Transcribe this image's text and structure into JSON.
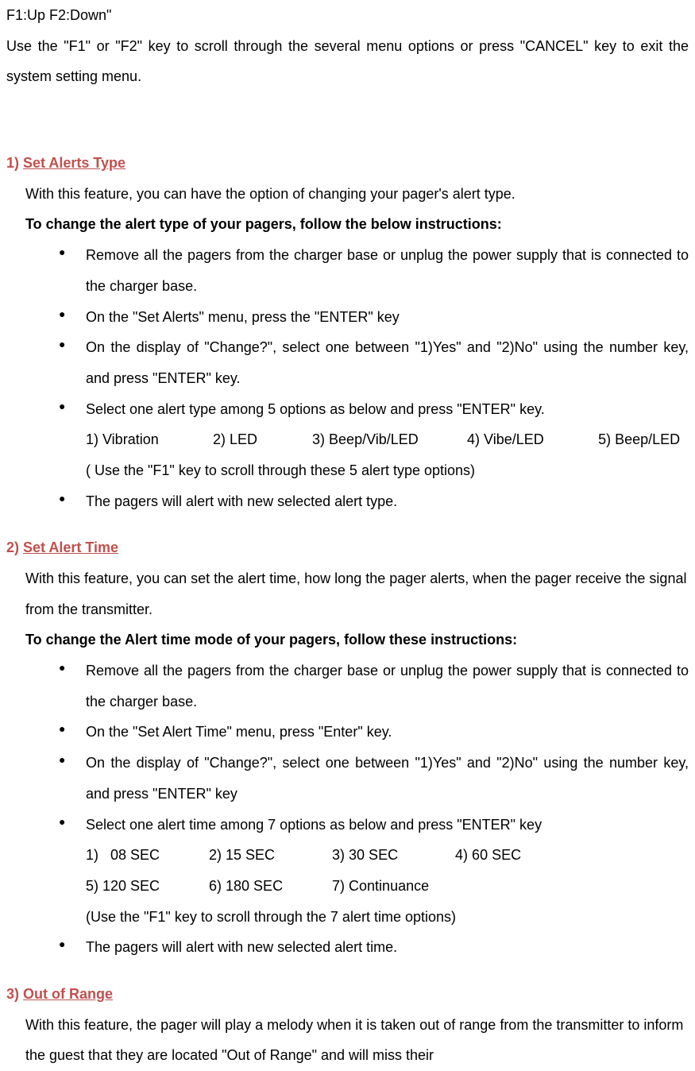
{
  "top": {
    "line1": "F1:Up   F2:Down\"",
    "line2": "Use the \"F1\" or \"F2\" key to scroll through the several menu options or press \"CANCEL\" key to exit the system setting menu."
  },
  "sections": {
    "s1": {
      "num": "1) ",
      "title": "Set Alerts Type",
      "intro": "With this feature, you can have the option of changing your pager's alert type.",
      "bold": "To change the alert type of your pagers, follow the below instructions:",
      "b1": "Remove all the pagers from the charger base or unplug the power supply that is connected to the charger base.",
      "b2": "On the \"Set Alerts\" menu, press the \"ENTER\" key",
      "b3": "On the display of \"Change?\", select one between \"1)Yes\" and \"2)No\" using the number key, and press \"ENTER\" key.",
      "b4": "Select one alert type among 5 options as below and press \"ENTER\" key.",
      "opts": {
        "o1": "1) Vibration",
        "o2": "2) LED",
        "o3": "3) Beep/Vib/LED",
        "o4": "4) Vibe/LED",
        "o5": "5) Beep/LED"
      },
      "note": "( Use the \"F1\" key to scroll through these 5 alert type options)",
      "b5": "The pagers will alert with new selected alert type."
    },
    "s2": {
      "num": "2) ",
      "title": "Set Alert Time",
      "intro": "With this feature, you can set the alert time, how long the pager alerts, when the pager receive the signal from the transmitter.",
      "bold": "To change the Alert time mode of your pagers, follow these instructions:",
      "b1": "Remove all the pagers from the charger base or unplug the power supply that is connected to the charger base.",
      "b2": "On the \"Set Alert Time\" menu, press \"Enter\" key.",
      "b3": "On the display of \"Change?\", select one between \"1)Yes\" and \"2)No\" using the number key, and press \"ENTER\" key",
      "b4": "Select one alert time among 7 options as below and press \"ENTER\" key",
      "opts1": {
        "o1": "1)   08 SEC",
        "o2": "2) 15 SEC",
        "o3": "3) 30 SEC",
        "o4": "4) 60 SEC"
      },
      "opts2": {
        "o5": "5) 120 SEC",
        "o6": "6) 180 SEC",
        "o7": "7) Continuance"
      },
      "note": "(Use the \"F1\" key to scroll through the 7 alert time options)",
      "b5": "The pagers will alert with new selected alert time."
    },
    "s3": {
      "num": "3) ",
      "title": "Out of Range",
      "intro": "With this feature, the pager will play a melody when it is taken out of range from the transmitter to inform the guest that they are located \"Out of Range\" and will miss their"
    }
  }
}
